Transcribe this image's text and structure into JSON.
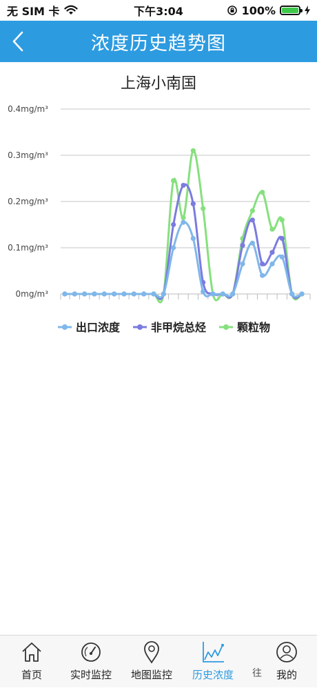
{
  "status": {
    "carrier": "无 SIM 卡",
    "time": "下午3:04",
    "battery": "100%"
  },
  "nav": {
    "title": "浓度历史趋势图"
  },
  "colors": {
    "primary": "#2d9be0",
    "series_outlet": "#7fb7ea",
    "series_nmhc": "#7b7be0",
    "series_particulate": "#86e07e"
  },
  "chart_data": {
    "type": "line",
    "title": "上海小南国",
    "ylim": [
      0,
      0.4
    ],
    "y_ticks": [
      "0mg/m³",
      "0.1mg/m³",
      "0.2mg/m³",
      "0.3mg/m³",
      "0.4mg/m³"
    ],
    "grid": true,
    "legend_position": "bottom-left",
    "series": [
      {
        "name": "出口浓度",
        "values": [
          0,
          0,
          0,
          0,
          0,
          0,
          0,
          0,
          0,
          0,
          0,
          0.1,
          0.155,
          0.12,
          0.005,
          0,
          0,
          0,
          0.065,
          0.11,
          0.04,
          0.065,
          0.08,
          0,
          0
        ]
      },
      {
        "name": "非甲烷总烃",
        "values": [
          0,
          0,
          0,
          0,
          0,
          0,
          0,
          0,
          0,
          0,
          0,
          0.15,
          0.235,
          0.195,
          0.025,
          0,
          0,
          0,
          0.105,
          0.16,
          0.065,
          0.09,
          0.12,
          0,
          0
        ]
      },
      {
        "name": "颗粒物",
        "values": [
          0,
          0,
          0,
          0,
          0,
          0,
          0,
          0,
          0,
          0,
          0,
          0.245,
          0.165,
          0.31,
          0.185,
          0,
          0,
          0,
          0.12,
          0.18,
          0.22,
          0.14,
          0.16,
          0,
          0
        ]
      }
    ]
  },
  "tabs": [
    {
      "label": "首页",
      "icon": "home-icon"
    },
    {
      "label": "实时监控",
      "icon": "gauge-icon"
    },
    {
      "label": "地图监控",
      "icon": "location-pin-icon"
    },
    {
      "label": "历史浓度",
      "icon": "trend-chart-icon"
    },
    {
      "label": "我的",
      "icon": "user-icon"
    }
  ],
  "tab_peek_char": "往"
}
